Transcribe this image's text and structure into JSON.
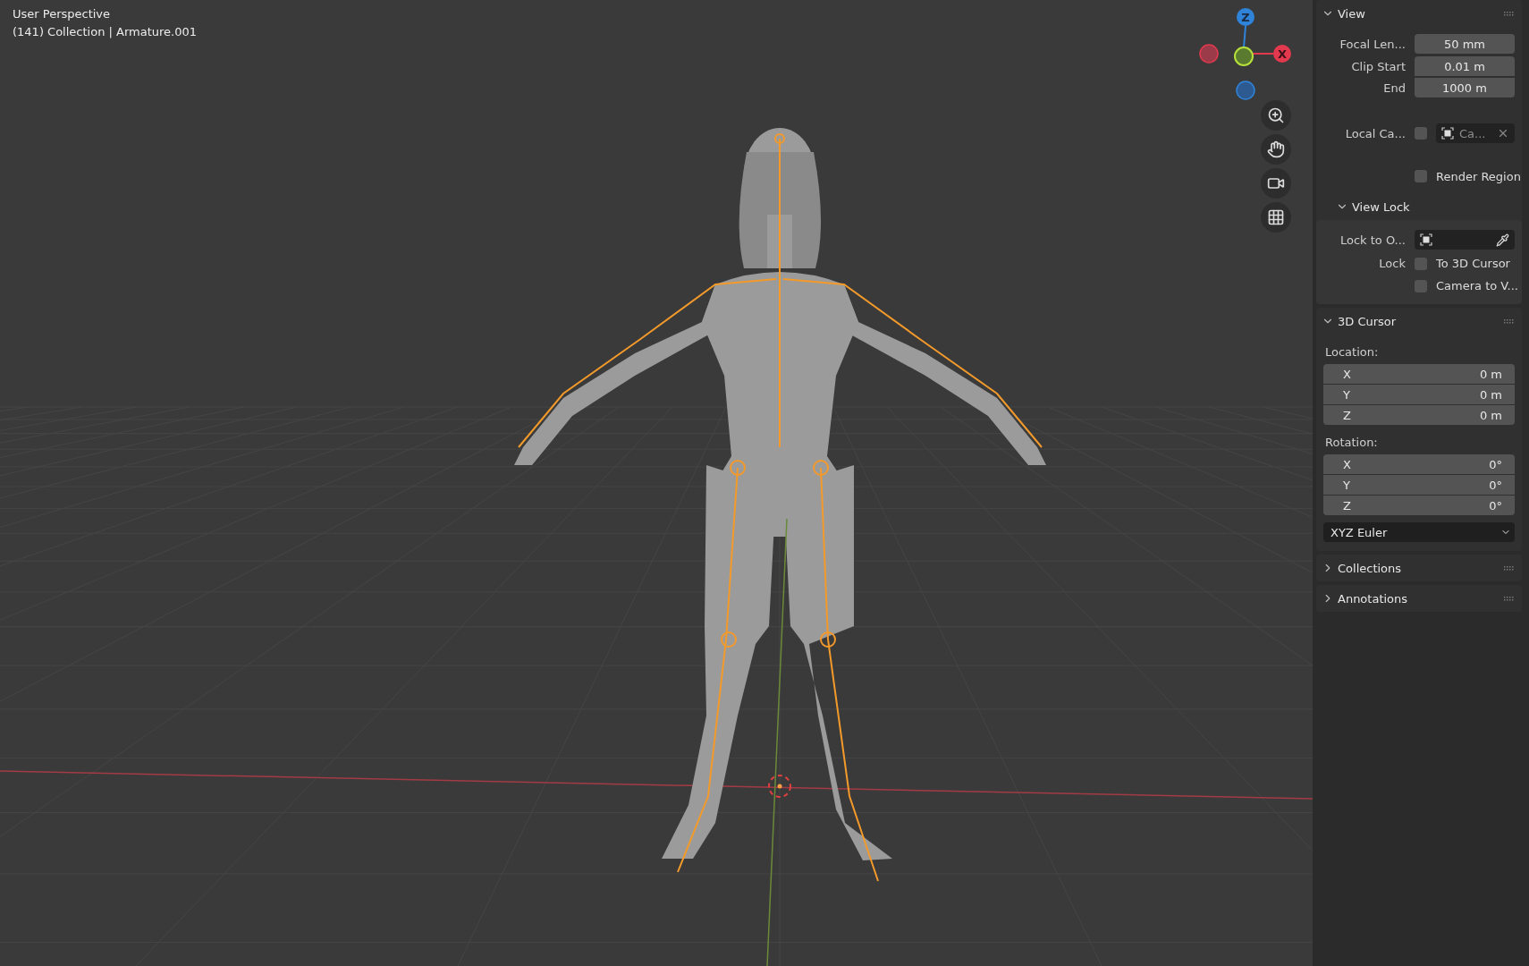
{
  "viewport": {
    "view_name": "User Perspective",
    "context": "(141) Collection | Armature.001",
    "gizmo_axes": [
      {
        "label": "Z",
        "color": "#2f83d9"
      },
      {
        "label": "X",
        "color": "#e2394f"
      }
    ]
  },
  "view": {
    "title": "View",
    "expanded": true,
    "fields": [
      {
        "label": "Focal Len...",
        "value": "50 mm"
      },
      {
        "label": "Clip Start",
        "value": "0.01 m"
      },
      {
        "label": "End",
        "value": "1000 m"
      }
    ],
    "local_camera": {
      "label": "Local Ca...",
      "checked": false,
      "camera": "Ca..."
    },
    "render_region": {
      "label": "Render Region",
      "checked": false
    },
    "view_lock": {
      "title": "View Lock",
      "expanded": true,
      "lock_to_object": "Lock to O...",
      "lock_label": "Lock",
      "options": [
        {
          "label": "To 3D Cursor",
          "checked": false
        },
        {
          "label": "Camera to V...",
          "checked": false
        }
      ]
    }
  },
  "cursor": {
    "title": "3D Cursor",
    "expanded": true,
    "location_label": "Location:",
    "location": [
      {
        "axis": "X",
        "value": "0 m"
      },
      {
        "axis": "Y",
        "value": "0 m"
      },
      {
        "axis": "Z",
        "value": "0 m"
      }
    ],
    "rotation_label": "Rotation:",
    "rotation": [
      {
        "axis": "X",
        "value": "0°"
      },
      {
        "axis": "Y",
        "value": "0°"
      },
      {
        "axis": "Z",
        "value": "0°"
      }
    ],
    "rotation_mode": "XYZ Euler"
  },
  "collapsed_panels": [
    {
      "title": "Collections",
      "expanded": false
    },
    {
      "title": "Annotations",
      "expanded": false
    }
  ]
}
